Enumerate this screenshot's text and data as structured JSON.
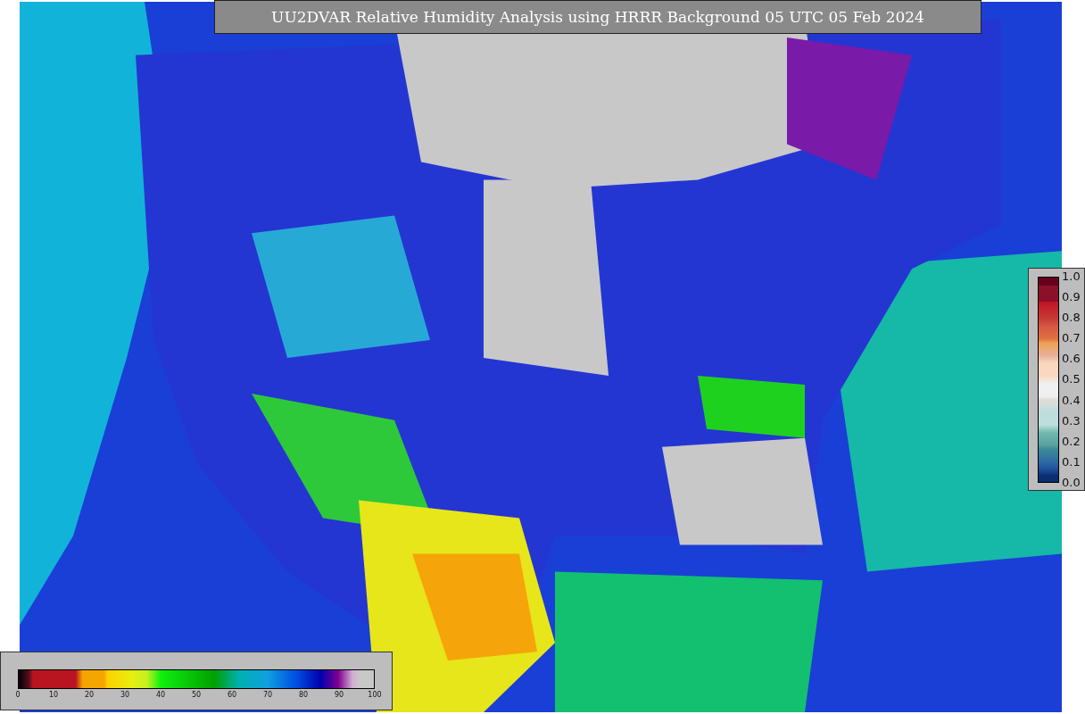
{
  "title": "UU2DVAR Relative Humidity Analysis using HRRR Background 05 UTC 05 Feb 2024",
  "humidity_legend": {
    "ticks": [
      "0",
      "10",
      "20",
      "30",
      "40",
      "50",
      "60",
      "70",
      "80",
      "90",
      "100"
    ]
  },
  "observation_legend": {
    "ticks": [
      "1.0",
      "0.9",
      "0.8",
      "0.7",
      "0.6",
      "0.5",
      "0.4",
      "0.3",
      "0.2",
      "0.1",
      "0.0"
    ]
  }
}
